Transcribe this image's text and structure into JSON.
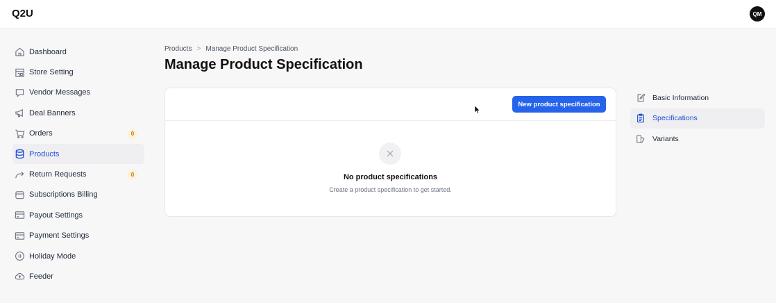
{
  "app": {
    "brand": "Q2U",
    "avatar_initials": "QM"
  },
  "sidebar": {
    "items": [
      {
        "label": "Dashboard",
        "icon": "home-icon"
      },
      {
        "label": "Store Setting",
        "icon": "store-icon"
      },
      {
        "label": "Vendor Messages",
        "icon": "chat-icon"
      },
      {
        "label": "Deal Banners",
        "icon": "megaphone-icon"
      },
      {
        "label": "Orders",
        "icon": "cart-icon",
        "badge": "0"
      },
      {
        "label": "Products",
        "icon": "database-icon",
        "active": true
      },
      {
        "label": "Return Requests",
        "icon": "return-arrow-icon",
        "badge": "0"
      },
      {
        "label": "Subscriptions Billing",
        "icon": "wallet-icon"
      },
      {
        "label": "Payout Settings",
        "icon": "card-icon"
      },
      {
        "label": "Payment Settings",
        "icon": "card-icon"
      },
      {
        "label": "Holiday Mode",
        "icon": "pause-icon"
      },
      {
        "label": "Feeder",
        "icon": "cloud-upload-icon"
      }
    ]
  },
  "breadcrumb": {
    "parent": "Products",
    "separator": ">",
    "current": "Manage Product Specification"
  },
  "page": {
    "title": "Manage Product Specification"
  },
  "card": {
    "new_button_label": "New product specification",
    "empty_title": "No product specifications",
    "empty_subtitle": "Create a product specification to get started."
  },
  "side_nav": {
    "items": [
      {
        "label": "Basic Information",
        "icon": "edit-icon"
      },
      {
        "label": "Specifications",
        "icon": "clipboard-icon",
        "active": true
      },
      {
        "label": "Variants",
        "icon": "variants-icon"
      }
    ]
  },
  "colors": {
    "accent": "#2563eb",
    "active_bg": "#efeff1",
    "badge_bg": "#fdf1d6"
  }
}
